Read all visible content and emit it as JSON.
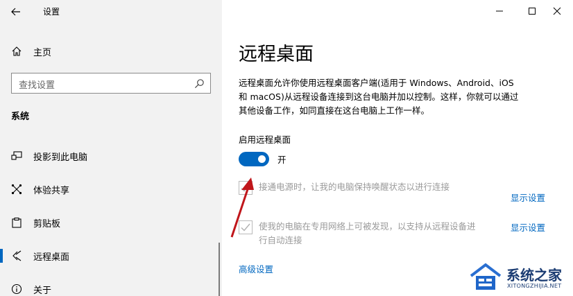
{
  "window": {
    "title": "设置",
    "controls": {
      "minimize": "minimize-icon",
      "maximize": "maximize-icon",
      "close": "close-icon"
    }
  },
  "sidebar": {
    "home_label": "主页",
    "search_placeholder": "查找设置",
    "section_title": "系统",
    "items": [
      {
        "label": "投影到此电脑",
        "icon": "project-screen-icon"
      },
      {
        "label": "体验共享",
        "icon": "share-experience-icon"
      },
      {
        "label": "剪贴板",
        "icon": "clipboard-icon"
      },
      {
        "label": "远程桌面",
        "icon": "remote-desktop-icon",
        "selected": true
      },
      {
        "label": "关于",
        "icon": "info-icon"
      }
    ]
  },
  "main": {
    "title": "远程桌面",
    "description_lines": [
      "远程桌面允许你使用远程桌面客户端(适用于 Windows、Android、iOS",
      "和 macOS)从远程设备连接到这台电脑并加以控制。这样，你就可以通过",
      "其他设备工作，如同直接在这台电脑上工作一样。"
    ],
    "toggle_label": "启用远程桌面",
    "toggle_state": "开",
    "toggle_on": true,
    "checkbox1_text": "接通电源时，让我的电脑保持唤醒状态以进行连接",
    "checkbox1_link": "显示设置",
    "checkbox2_lines": [
      "使我的电脑在专用网络上可被发现，以支持从远程设备进",
      "行自动连接"
    ],
    "checkbox2_link": "显示设置",
    "advanced_link": "高级设置"
  },
  "watermark": {
    "text": "系统之家",
    "sub": "XITONGZHIJIA.NET"
  },
  "colors": {
    "accent": "#0067c0",
    "sidebar_bg": "#f2f2f2",
    "arrow": "#c0161b"
  }
}
